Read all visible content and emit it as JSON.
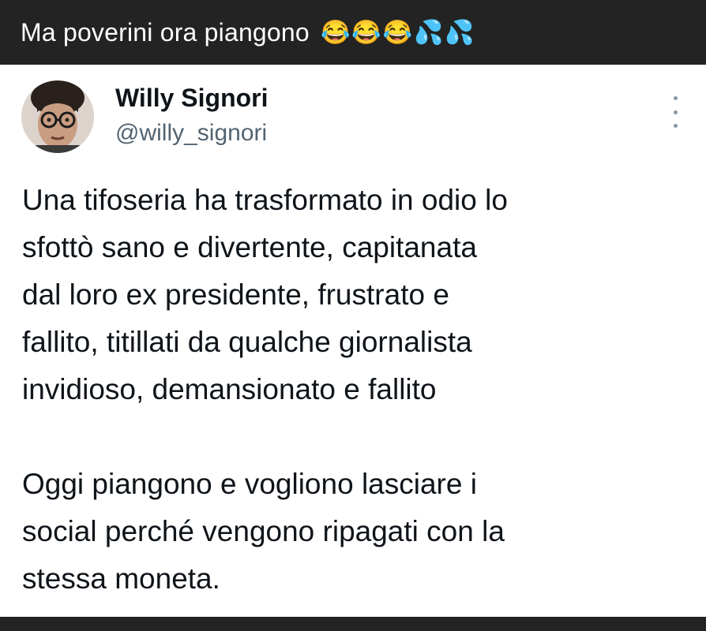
{
  "caption": {
    "text": "Ma poverini ora piangono",
    "emojis": "😂😂😂💦💦"
  },
  "tweet": {
    "display_name": "Willy Signori",
    "handle": "@willy_signori",
    "paragraph1": [
      "Una tifoseria ha trasformato in odio lo",
      "sfottò sano e divertente, capitanata",
      "dal loro ex presidente, frustrato e",
      "fallito, titillati da qualche giornalista",
      "invidioso, demansionato e fallito"
    ],
    "paragraph2": [
      "Oggi piangono e vogliono lasciare i",
      "social perché vengono ripagati con la",
      "stessa moneta."
    ]
  },
  "icons": {
    "more": "more-vertical-icon",
    "avatar": "profile-avatar"
  },
  "colors": {
    "caption_bg": "#232323",
    "caption_text": "#ffffff",
    "tweet_text": "#0f1419",
    "handle": "#536471"
  }
}
